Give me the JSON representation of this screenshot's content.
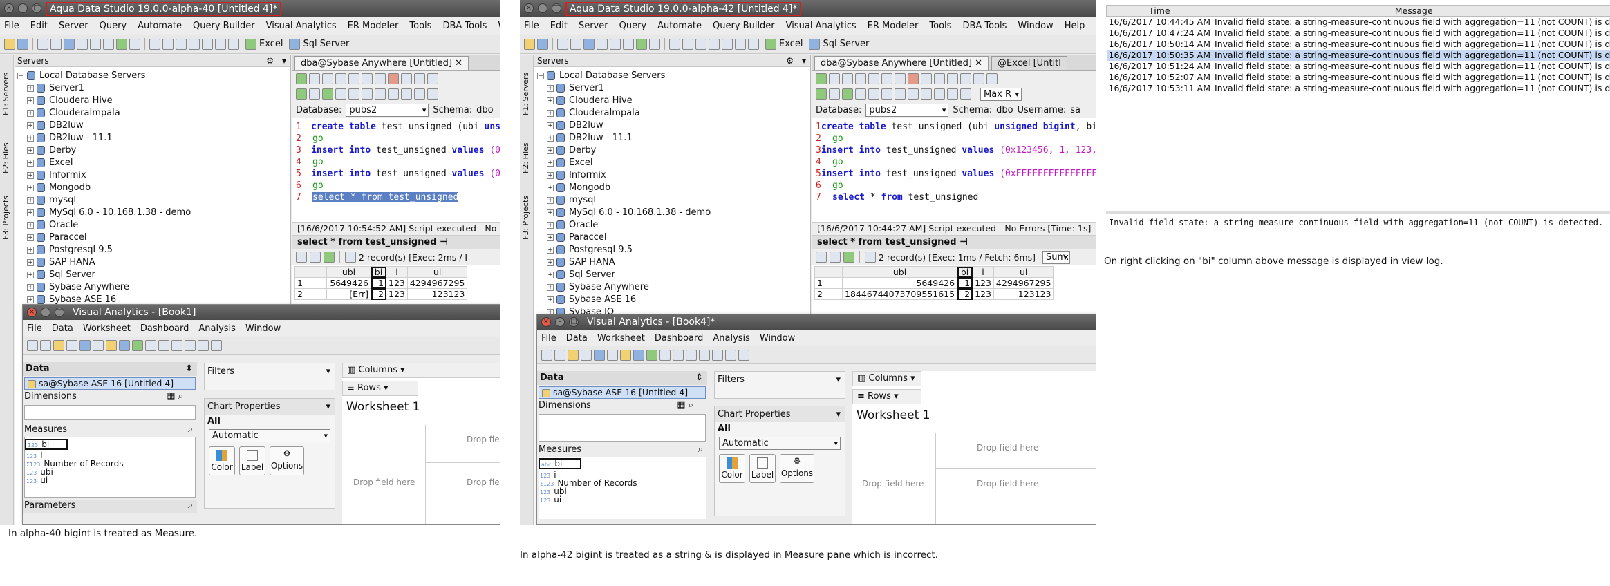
{
  "left": {
    "title": "Aqua Data Studio 19.0.0-alpha-40 [Untitled 4]*",
    "menu": [
      "File",
      "Edit",
      "Server",
      "Query",
      "Automate",
      "Query Builder",
      "Visual Analytics",
      "ER Modeler",
      "Tools",
      "DBA Tools",
      "Wi"
    ],
    "toolbar": {
      "excel": "Excel",
      "sql_server": "Sql Server"
    },
    "servers_label": "Servers",
    "side_tabs": [
      "F1: Servers",
      "F2: Files",
      "F3: Projects"
    ],
    "tree_root": "Local Database Servers",
    "tree_items": [
      "Server1",
      "Cloudera Hive",
      "ClouderaImpala",
      "DB2luw",
      "DB2luw - 11.1",
      "Derby",
      "Excel",
      "Informix",
      "Mongodb",
      "mysql",
      "MySql 6.0 - 10.168.1.38 - demo",
      "Oracle",
      "Paraccel",
      "Postgresql 9.5",
      "SAP HANA",
      "Sql Server",
      "Sybase Anywhere",
      "Sybase ASE 16"
    ],
    "editor_tab": "dba@Sybase Anywhere [Untitled]",
    "database_label": "Database:",
    "database_value": "pubs2",
    "schema_label": "Schema:",
    "schema_value": "dbo",
    "code": [
      {
        "n": "1",
        "kw": "create table",
        "rest": " test_unsigned (ubi ",
        "kw2": "uns"
      },
      {
        "n": "2",
        "go": "go"
      },
      {
        "n": "3",
        "kw": "insert into",
        "rest": " test_unsigned ",
        "kw2": "values",
        "hex": " (0"
      },
      {
        "n": "4",
        "go": "go"
      },
      {
        "n": "5",
        "kw": "insert into",
        "rest": " test_unsigned ",
        "kw2": "values",
        "hex": " (0"
      },
      {
        "n": "6",
        "go": "go"
      },
      {
        "n": "7",
        "selected": "select * from test_unsigned"
      }
    ],
    "status": "[16/6/2017 10:54:52 AM] Script executed - No",
    "result_tab": "select * from test_unsigned",
    "records": "2 record(s) [Exec: 2ms / I",
    "grid": {
      "headers": [
        "",
        "ubi",
        "bi",
        "i",
        "ui"
      ],
      "rows": [
        [
          "1",
          "5649426",
          "1",
          "123",
          "4294967295"
        ],
        [
          "2",
          "[Err]",
          "2",
          "123",
          "123123"
        ]
      ]
    },
    "va": {
      "title": "Visual Analytics - [Book1]",
      "menu": [
        "File",
        "Data",
        "Worksheet",
        "Dashboard",
        "Analysis",
        "Window"
      ],
      "data": "Data",
      "connection": "sa@Sybase ASE 16 [Untitled 4]",
      "dimensions": "Dimensions",
      "measures": "Measures",
      "measure_items": [
        {
          "t": "123",
          "n": "bi"
        },
        {
          "t": "123",
          "n": "i"
        },
        {
          "t": "Σ123",
          "n": "Number of Records"
        },
        {
          "t": "123",
          "n": "ubi"
        },
        {
          "t": "123",
          "n": "ui"
        }
      ],
      "parameters": "Parameters",
      "filters": "Filters",
      "chart_props": "Chart Properties",
      "all": "All",
      "automatic": "Automatic",
      "color": "Color",
      "label": "Label",
      "options": "Options",
      "columns": "Columns",
      "rows": "Rows",
      "worksheet": "Worksheet 1",
      "drop": "Drop field here",
      "drop_cut": "Drop fiel"
    },
    "caption": "In alpha-40 bigint is treated as Measure."
  },
  "mid": {
    "title": "Aqua Data Studio 19.0.0-alpha-42 [Untitled 4]*",
    "menu": [
      "File",
      "Edit",
      "Server",
      "Query",
      "Automate",
      "Query Builder",
      "Visual Analytics",
      "ER Modeler",
      "Tools",
      "DBA Tools",
      "Window",
      "Help"
    ],
    "editor_tabs": [
      "dba@Sybase Anywhere [Untitled]",
      "@Excel [Untitl"
    ],
    "username_label": "Username:",
    "username_value": "sa",
    "max_label": "Max R",
    "code": [
      {
        "n": "1",
        "kw": "create table",
        "rest": " test_unsigned (ubi ",
        "kw2": "unsigned bigint",
        "rest2": ", bi"
      },
      {
        "n": "2",
        "go": "go"
      },
      {
        "n": "3",
        "kw": "insert into",
        "rest": " test_unsigned ",
        "kw2": "values",
        "hex": " (0x123456, 1, 123,"
      },
      {
        "n": "4",
        "go": "go"
      },
      {
        "n": "5",
        "kw": "insert into",
        "rest": " test_unsigned ",
        "kw2": "values",
        "hex": " (0xFFFFFFFFFFFFFFFF"
      },
      {
        "n": "6",
        "go": "go"
      },
      {
        "n": "7",
        "kw": "select",
        "rest": " * ",
        "kw2": "from",
        "rest2": " test_unsigned"
      }
    ],
    "status": "[16/6/2017 10:44:27 AM] Script executed - No Errors [Time: 1s]",
    "records": "2 record(s) [Exec: 1ms / Fetch: 6ms]",
    "sum": "Sum:",
    "grid": {
      "headers": [
        "",
        "ubi",
        "bi",
        "i",
        "ui"
      ],
      "rows": [
        [
          "1",
          "5649426",
          "1",
          "123",
          "4294967295"
        ],
        [
          "2",
          "18446744073709551615",
          "2",
          "123",
          "123123"
        ]
      ]
    },
    "va": {
      "title": "Visual Analytics - [Book4]*",
      "measure_items": [
        {
          "t": "abc",
          "n": "bi"
        },
        {
          "t": "123",
          "n": "i"
        },
        {
          "t": "Σ123",
          "n": "Number of Records"
        },
        {
          "t": "123",
          "n": "ubi"
        },
        {
          "t": "123",
          "n": "ui"
        }
      ]
    },
    "caption": "In alpha-42 bigint is treated as a string & is displayed in Measure pane which is incorrect."
  },
  "right": {
    "log_headers": [
      "Time",
      "Message"
    ],
    "log_rows": [
      [
        "16/6/2017 10:44:45 AM",
        "Invalid field state: a string-measure-continuous field with aggregation=11 (not COUNT) is d."
      ],
      [
        "16/6/2017 10:47:24 AM",
        "Invalid field state: a string-measure-continuous field with aggregation=11 (not COUNT) is d."
      ],
      [
        "16/6/2017 10:50:14 AM",
        "Invalid field state: a string-measure-continuous field with aggregation=11 (not COUNT) is d."
      ],
      [
        "16/6/2017 10:50:35 AM",
        "Invalid field state: a string-measure-continuous field with aggregation=11 (not COUNT) is d."
      ],
      [
        "16/6/2017 10:51:24 AM",
        "Invalid field state: a string-measure-continuous field with aggregation=11 (not COUNT) is d."
      ],
      [
        "16/6/2017 10:52:07 AM",
        "Invalid field state: a string-measure-continuous field with aggregation=11 (not COUNT) is d."
      ],
      [
        "16/6/2017 10:53:11 AM",
        "Invalid field state: a string-measure-continuous field with aggregation=11 (not COUNT) is d."
      ]
    ],
    "detail": "Invalid field state: a string-measure-continuous field with aggregation=11 (not COUNT) is detected.",
    "caption": "On right clicking on \"bi\" column above message is displayed in view log."
  }
}
